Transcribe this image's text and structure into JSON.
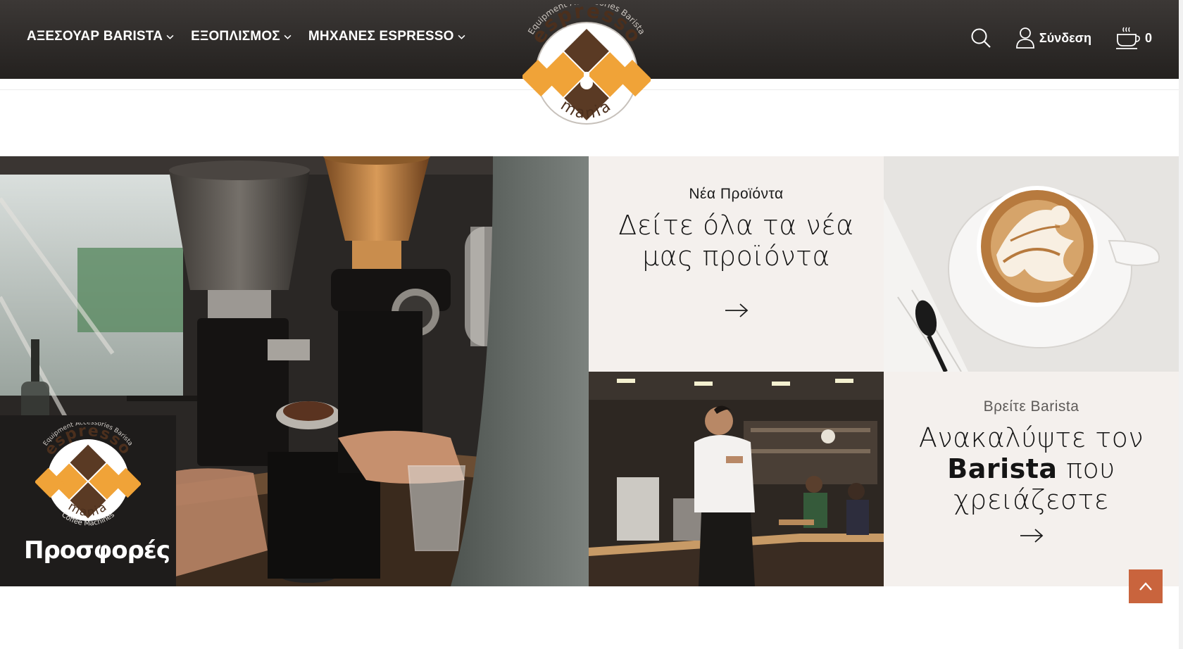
{
  "nav": {
    "items": [
      {
        "label": "ΑΞΕΣΟΥΑΡ BARISTA"
      },
      {
        "label": "ΕΞΟΠΛΙΣΜΟΣ"
      },
      {
        "label": "ΜΗΧΑΝΕΣ ESPRESSO"
      }
    ]
  },
  "logo": {
    "arc_text": "Equipment Accessories Barista",
    "word_top": "espresso",
    "word_bottom": "mania",
    "promo_sub": "Coffee Machines"
  },
  "header": {
    "login_label": "Σύνδεση",
    "cart_count": "0",
    "icons": [
      "search-icon",
      "user-icon",
      "cart-icon"
    ]
  },
  "promo": {
    "title": "Προσφορές"
  },
  "tiles": {
    "new_products": {
      "eyebrow": "Νέα Προϊόντα",
      "line1": "Δείτε όλα τα νέα",
      "line2": "μας προϊόντα"
    },
    "find_barista": {
      "eyebrow": "Βρείτε Barista",
      "line1": "Ανακαλύψτε τον",
      "bold": "Barista",
      "line2_rest": " που",
      "line3": "χρειάζεστε"
    }
  },
  "colors": {
    "accent": "#c9643d",
    "logo_orange": "#f0a338",
    "logo_brown": "#5a3a24",
    "tile_bg": "#f4f0ed",
    "header_bg": "#2d2a28"
  }
}
